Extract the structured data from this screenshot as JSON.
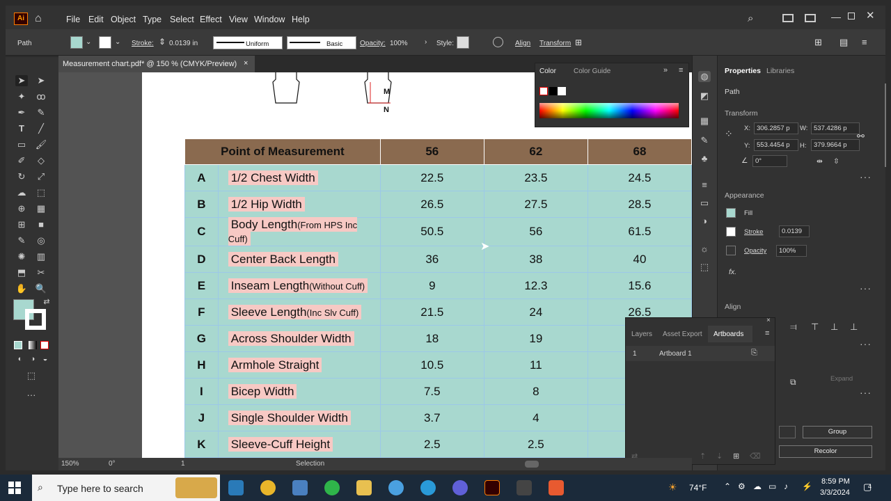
{
  "menubar": {
    "app_icon": "Ai",
    "items": [
      "File",
      "Edit",
      "Object",
      "Type",
      "Select",
      "Effect",
      "View",
      "Window",
      "Help"
    ]
  },
  "control": {
    "selection_type": "Path",
    "stroke_label": "Stroke:",
    "stroke_value": "0.0139 in",
    "profile_label": "Uniform",
    "brush_label": "Basic",
    "opacity_label": "Opacity:",
    "opacity_value": "100%",
    "style_label": "Style:",
    "align_label": "Align",
    "transform_label": "Transform"
  },
  "document": {
    "tab_title": "Measurement chart.pdf* @ 150 % (CMYK/Preview)",
    "close": "×"
  },
  "diagram": {
    "label_m": "M",
    "label_n": "N"
  },
  "table": {
    "headers": [
      "Point of Measurement",
      "56",
      "62",
      "68"
    ],
    "rows": [
      {
        "letter": "A",
        "name": "1/2 Chest Width",
        "sub": "",
        "v": [
          "22.5",
          "23.5",
          "24.5"
        ]
      },
      {
        "letter": "B",
        "name": "1/2 Hip Width",
        "sub": "",
        "v": [
          "26.5",
          "27.5",
          "28.5"
        ]
      },
      {
        "letter": "C",
        "name": "Body Length",
        "sub": "(From HPS Inc Cuff)",
        "v": [
          "50.5",
          "56",
          "61.5"
        ]
      },
      {
        "letter": "D",
        "name": "Center Back Length",
        "sub": "",
        "v": [
          "36",
          "38",
          "40"
        ]
      },
      {
        "letter": "E",
        "name": "Inseam Length",
        "sub": "(Without Cuff)",
        "v": [
          "9",
          "12.3",
          "15.6"
        ]
      },
      {
        "letter": "F",
        "name": "Sleeve Length",
        "sub": "(Inc Slv Cuff)",
        "v": [
          "21.5",
          "24",
          "26.5"
        ]
      },
      {
        "letter": "G",
        "name": "Across Shoulder Width",
        "sub": "",
        "v": [
          "18",
          "19",
          ""
        ]
      },
      {
        "letter": "H",
        "name": "Armhole Straight",
        "sub": "",
        "v": [
          "10.5",
          "11",
          ""
        ]
      },
      {
        "letter": "I",
        "name": "Bicep Width",
        "sub": "",
        "v": [
          "7.5",
          "8",
          ""
        ]
      },
      {
        "letter": "J",
        "name": "Single Shoulder Width",
        "sub": "",
        "v": [
          "3.7",
          "4",
          ""
        ]
      },
      {
        "letter": "K",
        "name": "Sleeve-Cuff Height",
        "sub": "",
        "v": [
          "2.5",
          "2.5",
          ""
        ]
      }
    ]
  },
  "color_panel": {
    "tab_color": "Color",
    "tab_guide": "Color Guide"
  },
  "properties": {
    "tab_props": "Properties",
    "tab_libs": "Libraries",
    "type": "Path",
    "transform": "Transform",
    "x_label": "X:",
    "x": "306.2857 p",
    "y_label": "Y:",
    "y": "553.4454 p",
    "w_label": "W:",
    "w": "537.4286 p",
    "h_label": "H:",
    "h": "379.9664 p",
    "angle": "0°",
    "appearance": "Appearance",
    "fill": "Fill",
    "stroke": "Stroke",
    "stroke_val": "0.0139",
    "opacity": "Opacity",
    "opacity_val": "100%",
    "fx": "fx.",
    "align": "Align",
    "expand": "Expand",
    "group": "Group",
    "recolor": "Recolor"
  },
  "layers_panel": {
    "tab_layers": "Layers",
    "tab_export": "Asset Export",
    "tab_artboards": "Artboards",
    "ab_num": "1",
    "ab_name": "Artboard 1"
  },
  "status": {
    "zoom": "150%",
    "rotate": "0°",
    "page": "1",
    "tool": "Selection"
  },
  "taskbar": {
    "search": "Type here to search",
    "weather": "74°F",
    "time": "8:59 PM",
    "date": "3/3/2024",
    "notif": "4"
  },
  "colors": {
    "fill": "#a8d8cf",
    "header": "#8a6a4f",
    "pink": "#f7c9c4",
    "accent": "#cc3300"
  }
}
